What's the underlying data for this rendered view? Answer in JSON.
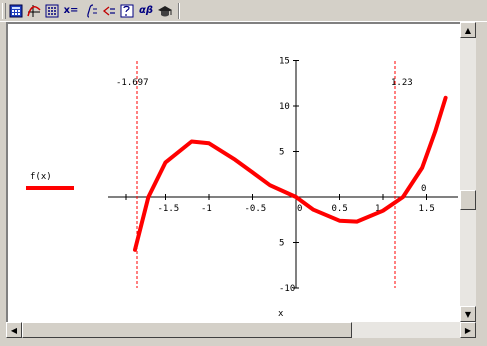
{
  "toolbar": {
    "items": [
      {
        "icon": "calculator-icon"
      },
      {
        "icon": "graph-icon"
      },
      {
        "icon": "matrix-icon"
      },
      {
        "label": "x="
      },
      {
        "icon": "calculus-icon"
      },
      {
        "icon": "boolean-icon"
      },
      {
        "icon": "programming-icon"
      },
      {
        "label": "αβ"
      },
      {
        "icon": "symbolic-icon"
      }
    ]
  },
  "plot": {
    "function_label": "f(x)",
    "x_axis_label": "x",
    "marker_left": "-1.697",
    "marker_right": "1.23",
    "marker_zero": "0",
    "x_tick_labels": [
      "-1.5",
      "-1",
      "-0.5",
      "0",
      "0.5",
      "1",
      "1.5"
    ],
    "y_tick_labels": [
      "15",
      "10",
      "5",
      "5",
      "-10"
    ],
    "trace_color": "#ff0000"
  },
  "chart_data": {
    "type": "line",
    "series": [
      {
        "name": "f(x)",
        "points": [
          [
            -1.85,
            -5.8
          ],
          [
            -1.697,
            0
          ],
          [
            -1.5,
            3.8
          ],
          [
            -1.2,
            6.1
          ],
          [
            -1.0,
            5.9
          ],
          [
            -0.7,
            4.1
          ],
          [
            -0.5,
            2.7
          ],
          [
            -0.3,
            1.3
          ],
          [
            0,
            0
          ],
          [
            0.2,
            -1.4
          ],
          [
            0.5,
            -2.6
          ],
          [
            0.7,
            -2.7
          ],
          [
            1.0,
            -1.5
          ],
          [
            1.23,
            0
          ],
          [
            1.45,
            3.2
          ],
          [
            1.6,
            7.2
          ],
          [
            1.72,
            10.9
          ]
        ]
      }
    ],
    "xlim": [
      -1.85,
      1.75
    ],
    "ylim": [
      -10,
      15
    ],
    "markers": {
      "vertical_lines_x": [
        -1.697,
        1.23
      ]
    }
  }
}
